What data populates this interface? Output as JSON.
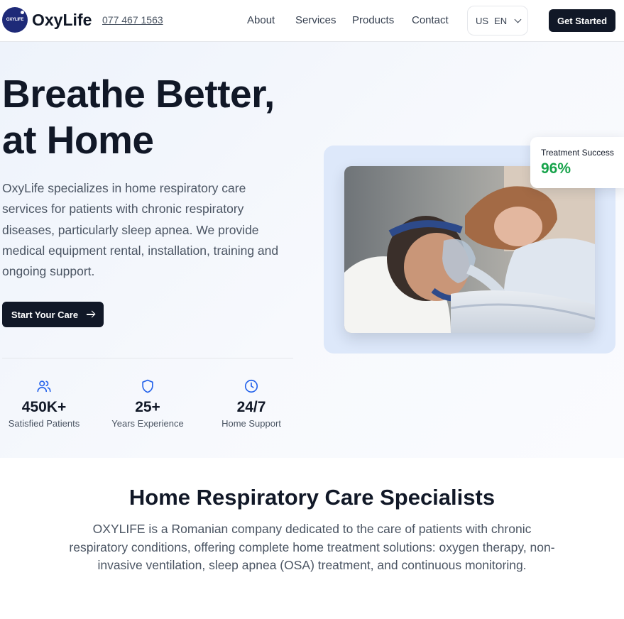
{
  "header": {
    "logo_text": "OXYLIFE",
    "brand": "OxyLife",
    "phone": "077 467 1563",
    "nav": [
      "About",
      "Services",
      "Products",
      "Contact"
    ],
    "lang_flag": "US",
    "lang_code": "EN",
    "cta": "Get Started"
  },
  "hero": {
    "title": "Breathe Better, at Home",
    "description": "OxyLife specializes in home respiratory care services for patients with chronic respiratory diseases, particularly sleep apnea. We provide medical equipment rental, installation, training and ongoing support.",
    "cta": "Start Your Care",
    "stats": [
      {
        "icon": "users-icon",
        "value": "450K+",
        "label": "Satisfied Patients"
      },
      {
        "icon": "shield-icon",
        "value": "25+",
        "label": "Years Experience"
      },
      {
        "icon": "clock-icon",
        "value": "24/7",
        "label": "Home Support"
      }
    ],
    "success_label": "Treatment Success",
    "success_value": "96%"
  },
  "about": {
    "title": "Home Respiratory Care Specialists",
    "description": "OXYLIFE is a Romanian company dedicated to the care of patients with chronic respiratory conditions, offering complete home treatment solutions: oxygen therapy, non-invasive ventilation, sleep apnea (OSA) treatment, and continuous monitoring."
  },
  "colors": {
    "primary_dark": "#111827",
    "accent_blue": "#2563eb",
    "success_green": "#16a34a",
    "brand_navy": "#1e2a78"
  }
}
